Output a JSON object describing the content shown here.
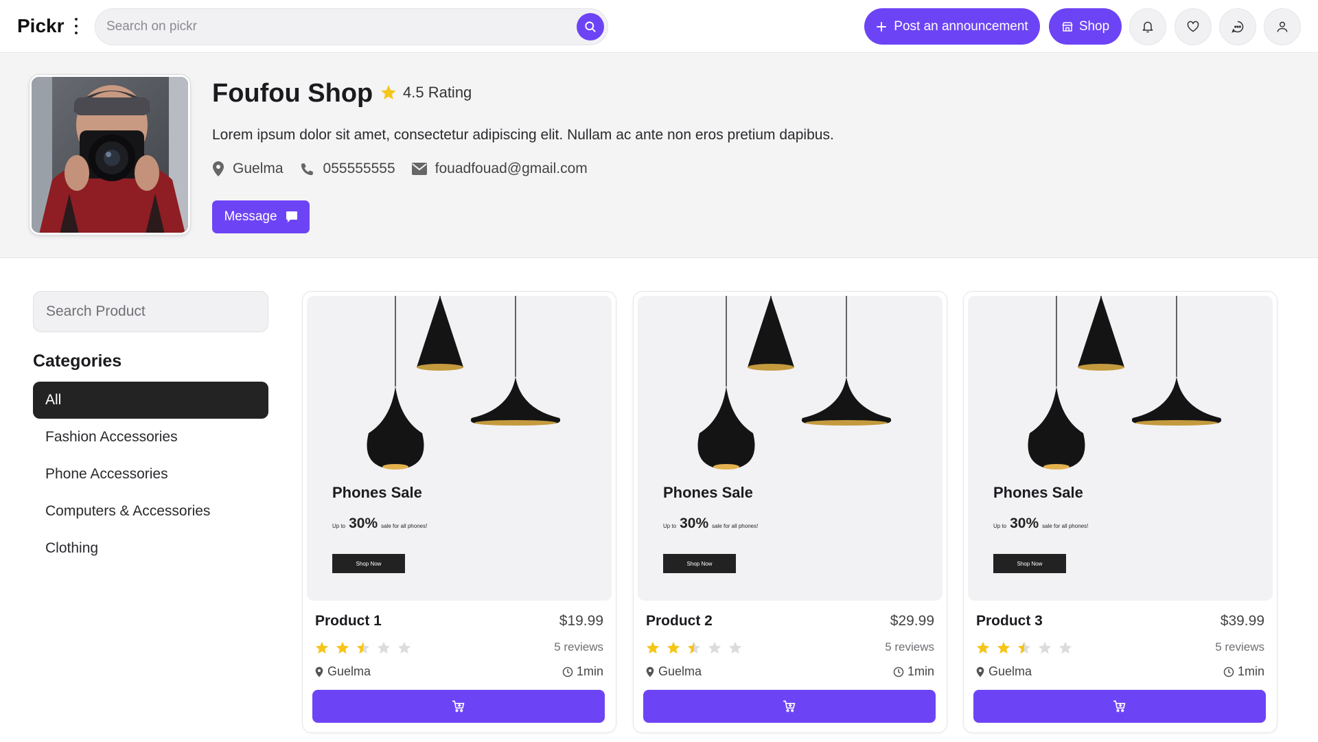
{
  "header": {
    "logo": "Pickr",
    "search_placeholder": "Search on pickr",
    "post_label": "Post an announcement",
    "shop_label": "Shop"
  },
  "shop": {
    "name": "Foufou Shop",
    "rating": "4.5 Rating",
    "description": "Lorem ipsum dolor sit amet, consectetur adipiscing elit. Nullam ac ante non eros pretium dapibus.",
    "location": "Guelma",
    "phone": "055555555",
    "email": "fouadfouad@gmail.com",
    "message_label": "Message"
  },
  "sidebar": {
    "search_placeholder": "Search Product",
    "categories_title": "Categories",
    "categories": [
      "All",
      "Fashion Accessories",
      "Phone Accessories",
      "Computers & Accessories",
      "Clothing"
    ]
  },
  "promo": {
    "title": "Phones Sale",
    "up_to": "Up to",
    "percent": "30%",
    "subtitle": "sale for all phones!",
    "button": "Shop Now"
  },
  "products": [
    {
      "name": "Product 1",
      "price": "$19.99",
      "reviews": "5 reviews",
      "location": "Guelma",
      "time": "1min",
      "rating": 2.5
    },
    {
      "name": "Product 2",
      "price": "$29.99",
      "reviews": "5 reviews",
      "location": "Guelma",
      "time": "1min",
      "rating": 2.5
    },
    {
      "name": "Product 3",
      "price": "$39.99",
      "reviews": "5 reviews",
      "location": "Guelma",
      "time": "1min",
      "rating": 2.5
    }
  ],
  "colors": {
    "accent": "#6d44f5",
    "star": "#f5c518",
    "star_empty": "#dcdcdf",
    "active_category": "#232323"
  },
  "icons": [
    "search-icon",
    "plus-icon",
    "store-icon",
    "bell-icon",
    "heart-icon",
    "chat-icon",
    "user-icon",
    "star-icon",
    "map-pin-icon",
    "phone-icon",
    "envelope-icon",
    "message-icon",
    "clock-icon",
    "cart-icon"
  ]
}
